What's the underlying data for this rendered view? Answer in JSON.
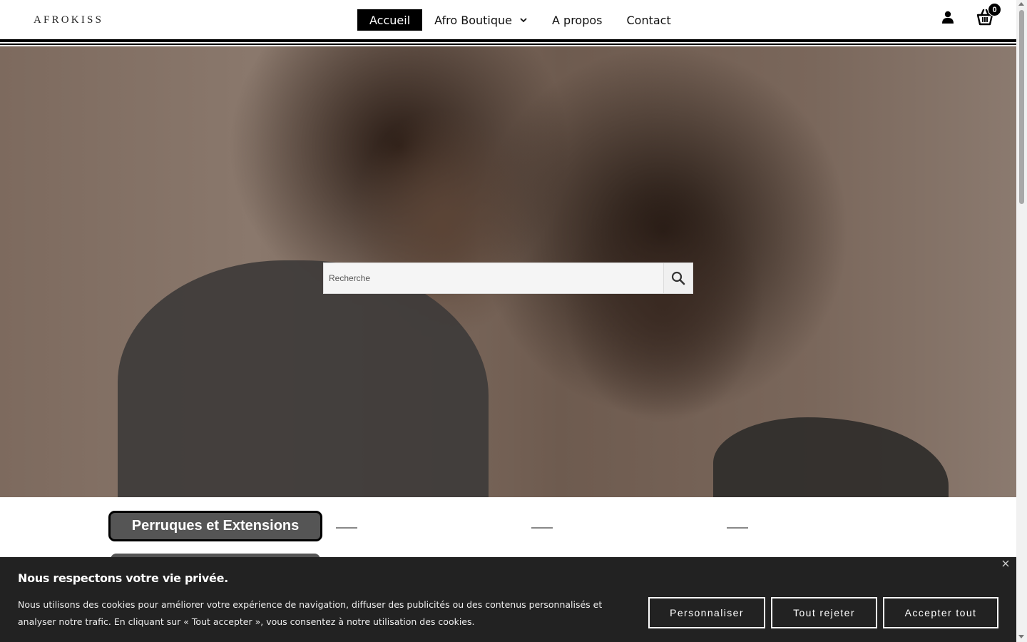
{
  "header": {
    "logo": "AFROKISS",
    "nav": [
      {
        "label": "Accueil",
        "active": true
      },
      {
        "label": "Afro Boutique",
        "has_dropdown": true
      },
      {
        "label": "A propos"
      },
      {
        "label": "Contact"
      }
    ],
    "account_icon": "user-icon",
    "cart_icon": "cart-icon",
    "cart_count": "0"
  },
  "hero": {
    "search_placeholder": "Recherche",
    "search_icon": "search-icon"
  },
  "categories": {
    "first_label": "Perruques et Extensions"
  },
  "cookie_banner": {
    "title": "Nous respectons votre vie privée.",
    "text": "Nous utilisons des cookies pour améliorer votre expérience de navigation, diffuser des publicités ou des contenus personnalisés et analyser notre trafic. En cliquant sur « Tout accepter », vous consentez à notre utilisation des cookies.",
    "buttons": {
      "customize": "Personnaliser",
      "reject": "Tout rejeter",
      "accept": "Accepter tout"
    },
    "close_icon": "close-icon"
  },
  "colors": {
    "accent": "#000000",
    "banner_bg": "#222222",
    "category_button": "#555555"
  }
}
